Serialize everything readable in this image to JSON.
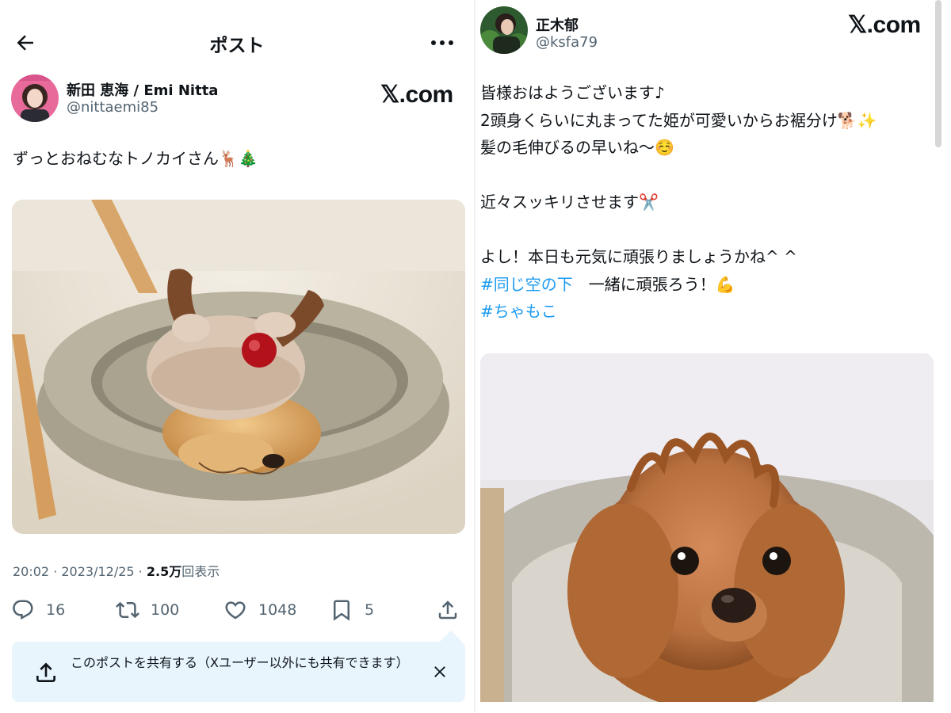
{
  "left": {
    "topbar": {
      "title": "ポスト",
      "back_icon": "arrow-left-icon",
      "more_icon": "more-dots-icon"
    },
    "author": {
      "name": "新田 恵海 / Emi Nitta",
      "handle": "@nittaemi85"
    },
    "watermark": "𝕏.com",
    "post_text": "ずっとおねむなトノカイさん🦌🎄",
    "image": {
      "description_icon": "sleeping-chihuahua-reindeer-hat-photo"
    },
    "meta": {
      "time": "20:02",
      "sep": " · ",
      "date": "2023/12/25",
      "sep2": " · ",
      "views": "2.5万",
      "views_label": "回表示"
    },
    "actions": {
      "reply": {
        "icon": "reply-icon",
        "count": "16"
      },
      "repost": {
        "icon": "repost-icon",
        "count": "100"
      },
      "like": {
        "icon": "heart-icon",
        "count": "1048"
      },
      "bookmark": {
        "icon": "bookmark-icon",
        "count": "5"
      },
      "share": {
        "icon": "share-icon"
      }
    },
    "share_banner": {
      "text": "このポストを共有する（Xユーザー以外にも共有できます）",
      "icon": "upload-icon",
      "close_icon": "close-icon"
    }
  },
  "right": {
    "author": {
      "name": "正木郁",
      "handle": "@ksfa79"
    },
    "watermark": "𝕏.com",
    "lines": {
      "l1": "皆様おはようございます♪",
      "l2": "2頭身くらいに丸まってた姫が可愛いからお裾分け🐕✨",
      "l3": "髪の毛伸びるの早いね〜☺️",
      "l4": "近々スッキリさせます✂️",
      "l5": "よし！本日も元気に頑張りましょうかね^ ^",
      "l6_tag": "#同じ空の下",
      "l6_rest": "　一緒に頑張ろう！💪",
      "l7_tag": "#ちゃもこ"
    },
    "image": {
      "description_icon": "fluffy-toy-poodle-photo"
    }
  },
  "colors": {
    "accent": "#1d9bf0",
    "secondary_text": "#536471",
    "banner_bg": "#e8f5fd"
  }
}
